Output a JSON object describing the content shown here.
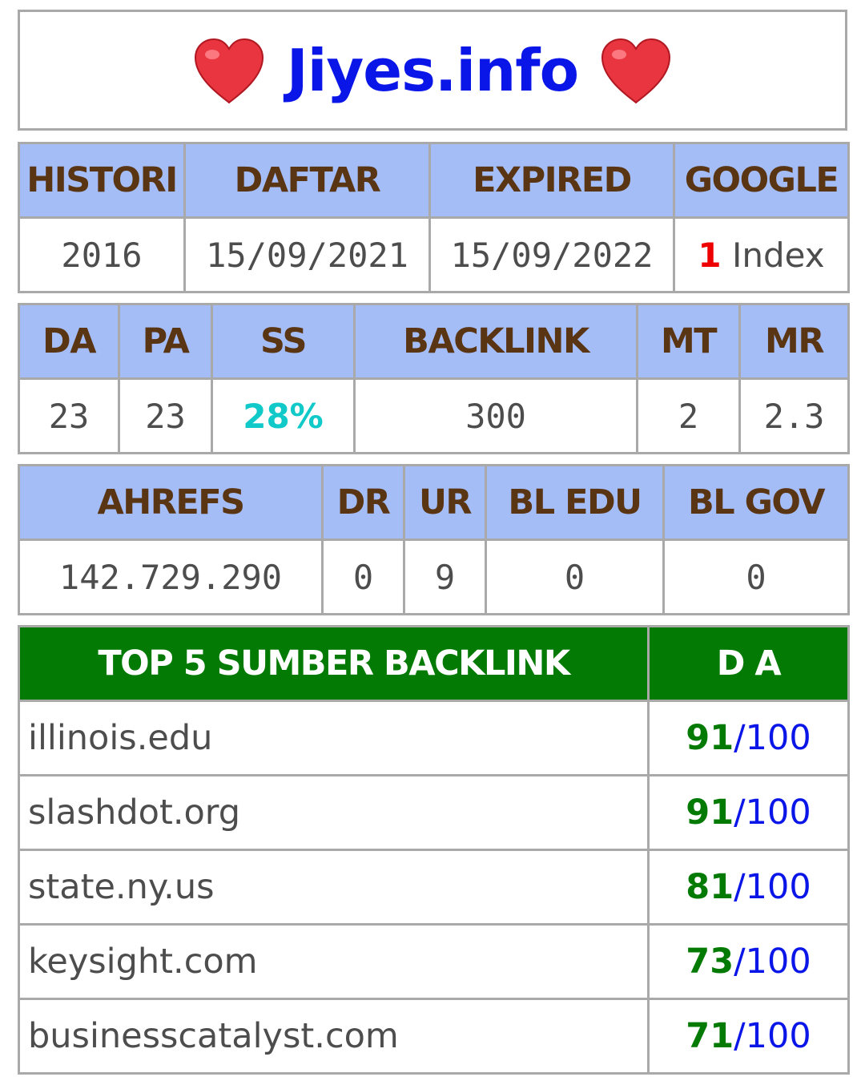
{
  "header": {
    "left_icon": "heart-icon",
    "site_name": "Jiyes.info",
    "right_icon": "heart-icon",
    "heart_color": "#e8353f"
  },
  "table_history": {
    "headers": [
      "HISTORI",
      "DAFTAR",
      "EXPIRED",
      "GOOGLE"
    ],
    "values": {
      "histori": "2016",
      "daftar": "15/09/2021",
      "expired": "15/09/2022",
      "google_count": "1",
      "google_label": "Index"
    }
  },
  "table_moz": {
    "headers": [
      "DA",
      "PA",
      "SS",
      "BACKLINK",
      "MT",
      "MR"
    ],
    "values": [
      "23",
      "23",
      "28%",
      "300",
      "2",
      "2.3"
    ]
  },
  "table_ahrefs": {
    "headers": [
      "AHREFS",
      "DR",
      "UR",
      "BL EDU",
      "BL GOV"
    ],
    "values": [
      "142.729.290",
      "0",
      "9",
      "0",
      "0"
    ]
  },
  "table_backlinks": {
    "headers": [
      "TOP 5 SUMBER BACKLINK",
      "D A"
    ],
    "rows": [
      {
        "site": "illinois.edu",
        "da": "91",
        "sep": "/",
        "max": "100"
      },
      {
        "site": "slashdot.org",
        "da": "91",
        "sep": "/",
        "max": "100"
      },
      {
        "site": "state.ny.us",
        "da": "81",
        "sep": "/",
        "max": "100"
      },
      {
        "site": "keysight.com",
        "da": "73",
        "sep": "/",
        "max": "100"
      },
      {
        "site": "businesscatalyst.com",
        "da": "71",
        "sep": "/",
        "max": "100"
      }
    ]
  },
  "colors": {
    "header_bg": "#a4bdf6",
    "header_text": "#5a3514",
    "top5_header_bg": "#037a03",
    "brand_blue": "#0a16e8",
    "index_red": "#ee0000",
    "ss_teal": "#12c9c9",
    "score_green": "#037a03"
  }
}
